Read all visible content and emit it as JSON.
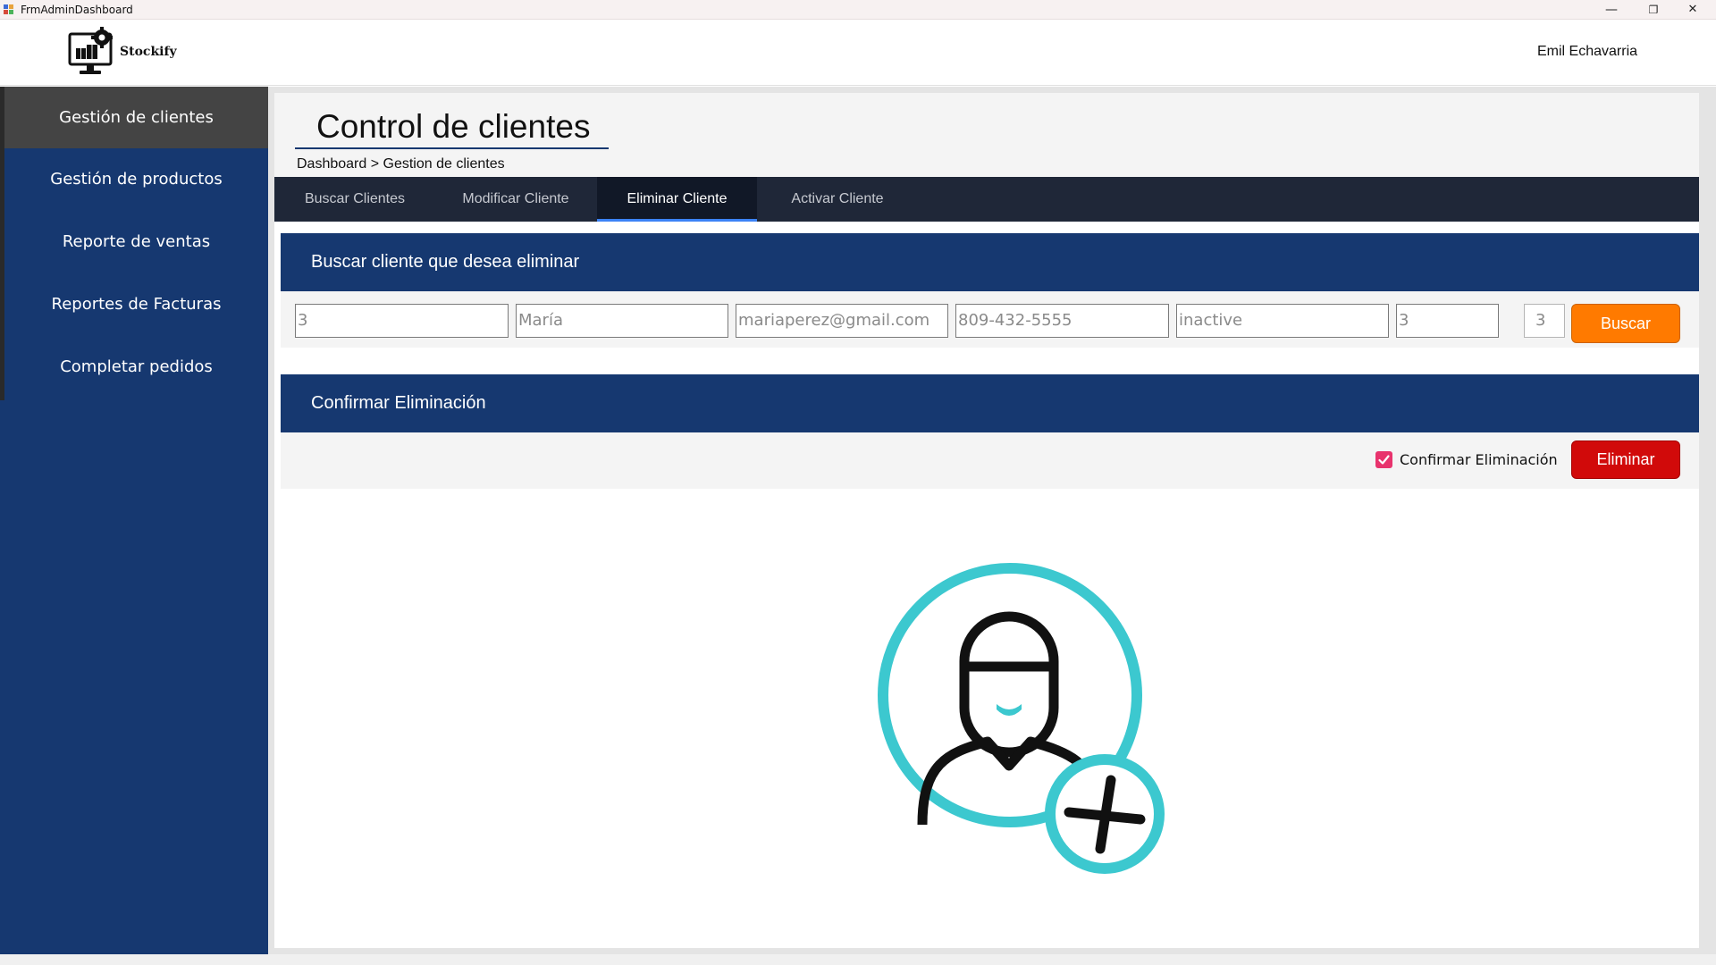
{
  "window": {
    "title": "FrmAdminDashboard",
    "controls": {
      "minimize": "—",
      "maximize": "❐",
      "close": "✕"
    }
  },
  "header": {
    "brand": "Stockify",
    "user": "Emil Echavarria",
    "logo_icon": "monitor-gear-boxes-icon"
  },
  "sidebar": {
    "items": [
      {
        "label": "Gestión de clientes",
        "active": true
      },
      {
        "label": "Gestión de productos",
        "active": false
      },
      {
        "label": "Reporte de ventas",
        "active": false
      },
      {
        "label": "Reportes de Facturas",
        "active": false
      },
      {
        "label": "Completar pedidos",
        "active": false
      }
    ]
  },
  "page": {
    "title": "Control de clientes",
    "breadcrumb": "Dashboard > Gestion de clientes"
  },
  "tabs": [
    {
      "label": "Buscar Clientes",
      "active": false
    },
    {
      "label": "Modificar Cliente",
      "active": false
    },
    {
      "label": "Eliminar Cliente",
      "active": true
    },
    {
      "label": "Activar Cliente",
      "active": false
    }
  ],
  "search_section": {
    "heading": "Buscar cliente que desea eliminar",
    "fields": {
      "id": "3",
      "name": "María",
      "email": "mariaperez@gmail.com",
      "phone": "809-432-5555",
      "status": "inactive",
      "extra": "3",
      "search_id": "3"
    },
    "button": "Buscar"
  },
  "confirm_section": {
    "heading": "Confirmar Eliminación",
    "checkbox_label": "Confirmar Eliminación",
    "checked": true,
    "button": "Eliminar"
  },
  "illustration": {
    "icon": "add-user-icon"
  },
  "colors": {
    "navy": "#163870",
    "tabbar": "#1f2738",
    "tab_active_underline": "#3b82f6",
    "buscar": "#ff7a00",
    "eliminar": "#d10a0a",
    "checkbox": "#e8336d",
    "teal": "#3cc8cf"
  }
}
